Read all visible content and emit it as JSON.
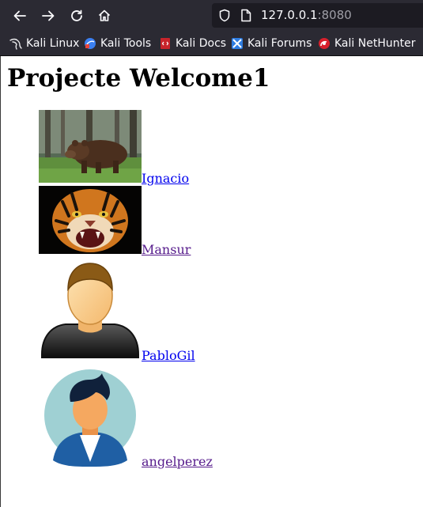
{
  "browser": {
    "url_host": "127.0.0.1",
    "url_port": ":8080",
    "bookmarks": [
      {
        "label": "Kali Linux",
        "icon": "kali-dragon-icon"
      },
      {
        "label": "Kali Tools",
        "icon": "kali-tools-icon"
      },
      {
        "label": "Kali Docs",
        "icon": "kali-docs-icon"
      },
      {
        "label": "Kali Forums",
        "icon": "kali-forums-icon"
      },
      {
        "label": "Kali NetHunter",
        "icon": "kali-nethunter-icon"
      }
    ]
  },
  "page": {
    "title": "Projecte Welcome1",
    "users": [
      {
        "name": "Ignacio",
        "image": "brown-bear-photo",
        "visited": false
      },
      {
        "name": "Mansur",
        "image": "tiger-photo",
        "visited": true
      },
      {
        "name": "PabloGil",
        "image": "male-avatar-illustration",
        "visited": false
      },
      {
        "name": "angelperez",
        "image": "round-avatar-illustration",
        "visited": true
      }
    ]
  }
}
